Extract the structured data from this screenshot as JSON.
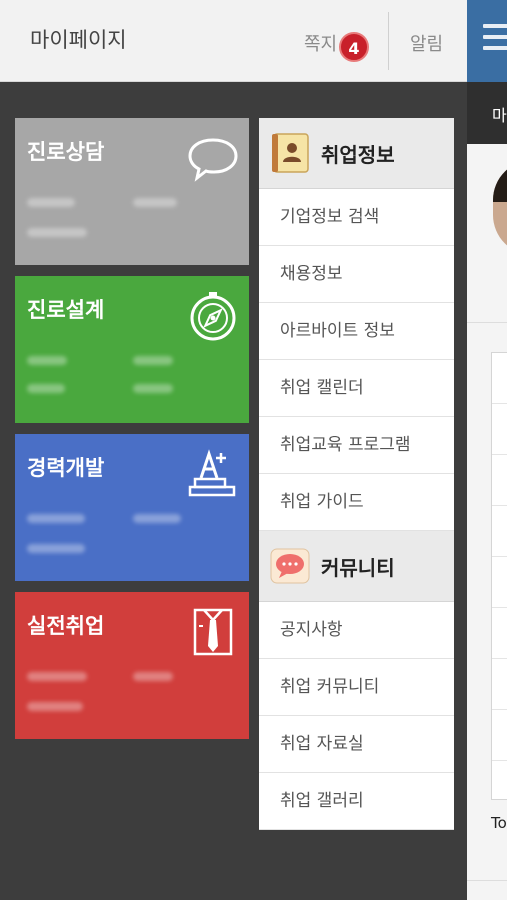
{
  "topbar": {
    "title": "마이페이지",
    "messages_label": "쪽지",
    "messages_count": "4",
    "alarm_label": "알림"
  },
  "peek": {
    "dark_text": "마",
    "bottom_text": "To"
  },
  "tiles": [
    {
      "title": "진로상담",
      "icon": "speech-bubble-icon",
      "color": "#a7a7a7"
    },
    {
      "title": "진로설계",
      "icon": "compass-icon",
      "color": "#4aa83e"
    },
    {
      "title": "경력개발",
      "icon": "grade-a-plus-icon",
      "color": "#4a6fc6"
    },
    {
      "title": "실전취업",
      "icon": "shirt-tie-icon",
      "color": "#d13e3c"
    }
  ],
  "menu": {
    "sections": [
      {
        "title": "취업정보",
        "icon": "address-book-icon",
        "items": [
          "기업정보 검색",
          "채용정보",
          "아르바이트 정보",
          "취업 캘린더",
          "취업교육 프로그램",
          "취업 가이드"
        ]
      },
      {
        "title": "커뮤니티",
        "icon": "chat-bubble-icon",
        "items": [
          "공지사항",
          "취업 커뮤니티",
          "취업 자료실",
          "취업 갤러리"
        ]
      }
    ]
  },
  "colors": {
    "accent_blue": "#3a6ea3",
    "badge_red": "#c8202a",
    "background": "#3d3d3d"
  }
}
